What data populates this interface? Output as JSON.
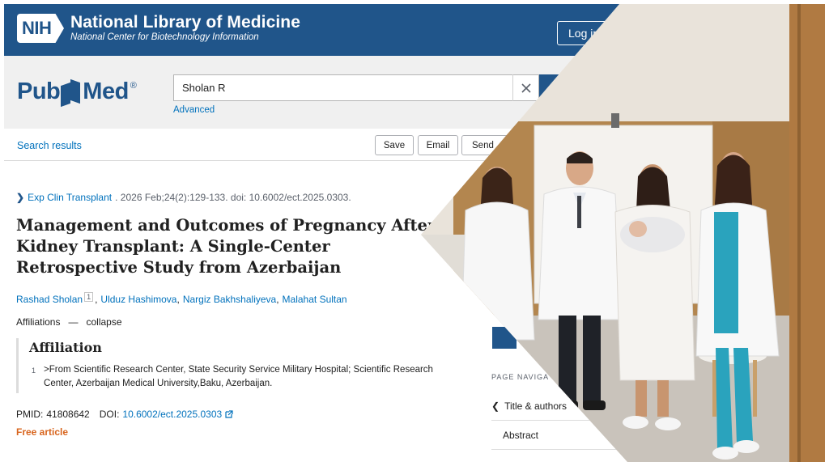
{
  "header": {
    "nih_badge": "NIH",
    "org_title": "National Library of Medicine",
    "org_subtitle": "National Center for Biotechnology Information",
    "login_label": "Log in"
  },
  "search": {
    "logo_pub": "Pub",
    "logo_med": "Med",
    "logo_reg": "®",
    "query": "Sholan R",
    "advanced_label": "Advanced"
  },
  "nav": {
    "search_results_label": "Search results",
    "save_label": "Save",
    "email_label": "Email",
    "send_label": "Send"
  },
  "article": {
    "journal": "Exp Clin Transplant",
    "citation_rest": ". 2026 Feb;24(2):129-133. doi: 10.6002/ect.2025.0303.",
    "title": "Management and Outcomes of Pregnancy After Kidney Transplant: A Single-Center Retrospective Study from Azerbaijan",
    "authors": [
      {
        "name": "Rashad Sholan",
        "sup": "1"
      },
      {
        "name": "Ulduz Hashimova"
      },
      {
        "name": "Nargiz Bakhshaliyeva"
      },
      {
        "name": "Malahat Sultan"
      }
    ],
    "affiliations_label": "Affiliations",
    "collapse_label": "collapse",
    "affiliation_heading": "Affiliation",
    "affiliation_number": "1",
    "affiliation_text": ">From Scientific Research Center, State Security Service Military Hospital; Scientific Research Center, Azerbaijan Medical University,Baku, Azerbaijan.",
    "pmid_label": "PMID:",
    "pmid_value": "41808642",
    "doi_label": "DOI:",
    "doi_value": "10.6002/ect.2025.0303",
    "free_article_label": "Free article"
  },
  "page_navigation": {
    "label": "PAGE NAVIGA",
    "items": [
      "Title & authors",
      "Abstract"
    ]
  },
  "colors": {
    "nih_blue": "#20558a",
    "link_blue": "#0071bc",
    "free_orange": "#d8651e"
  }
}
